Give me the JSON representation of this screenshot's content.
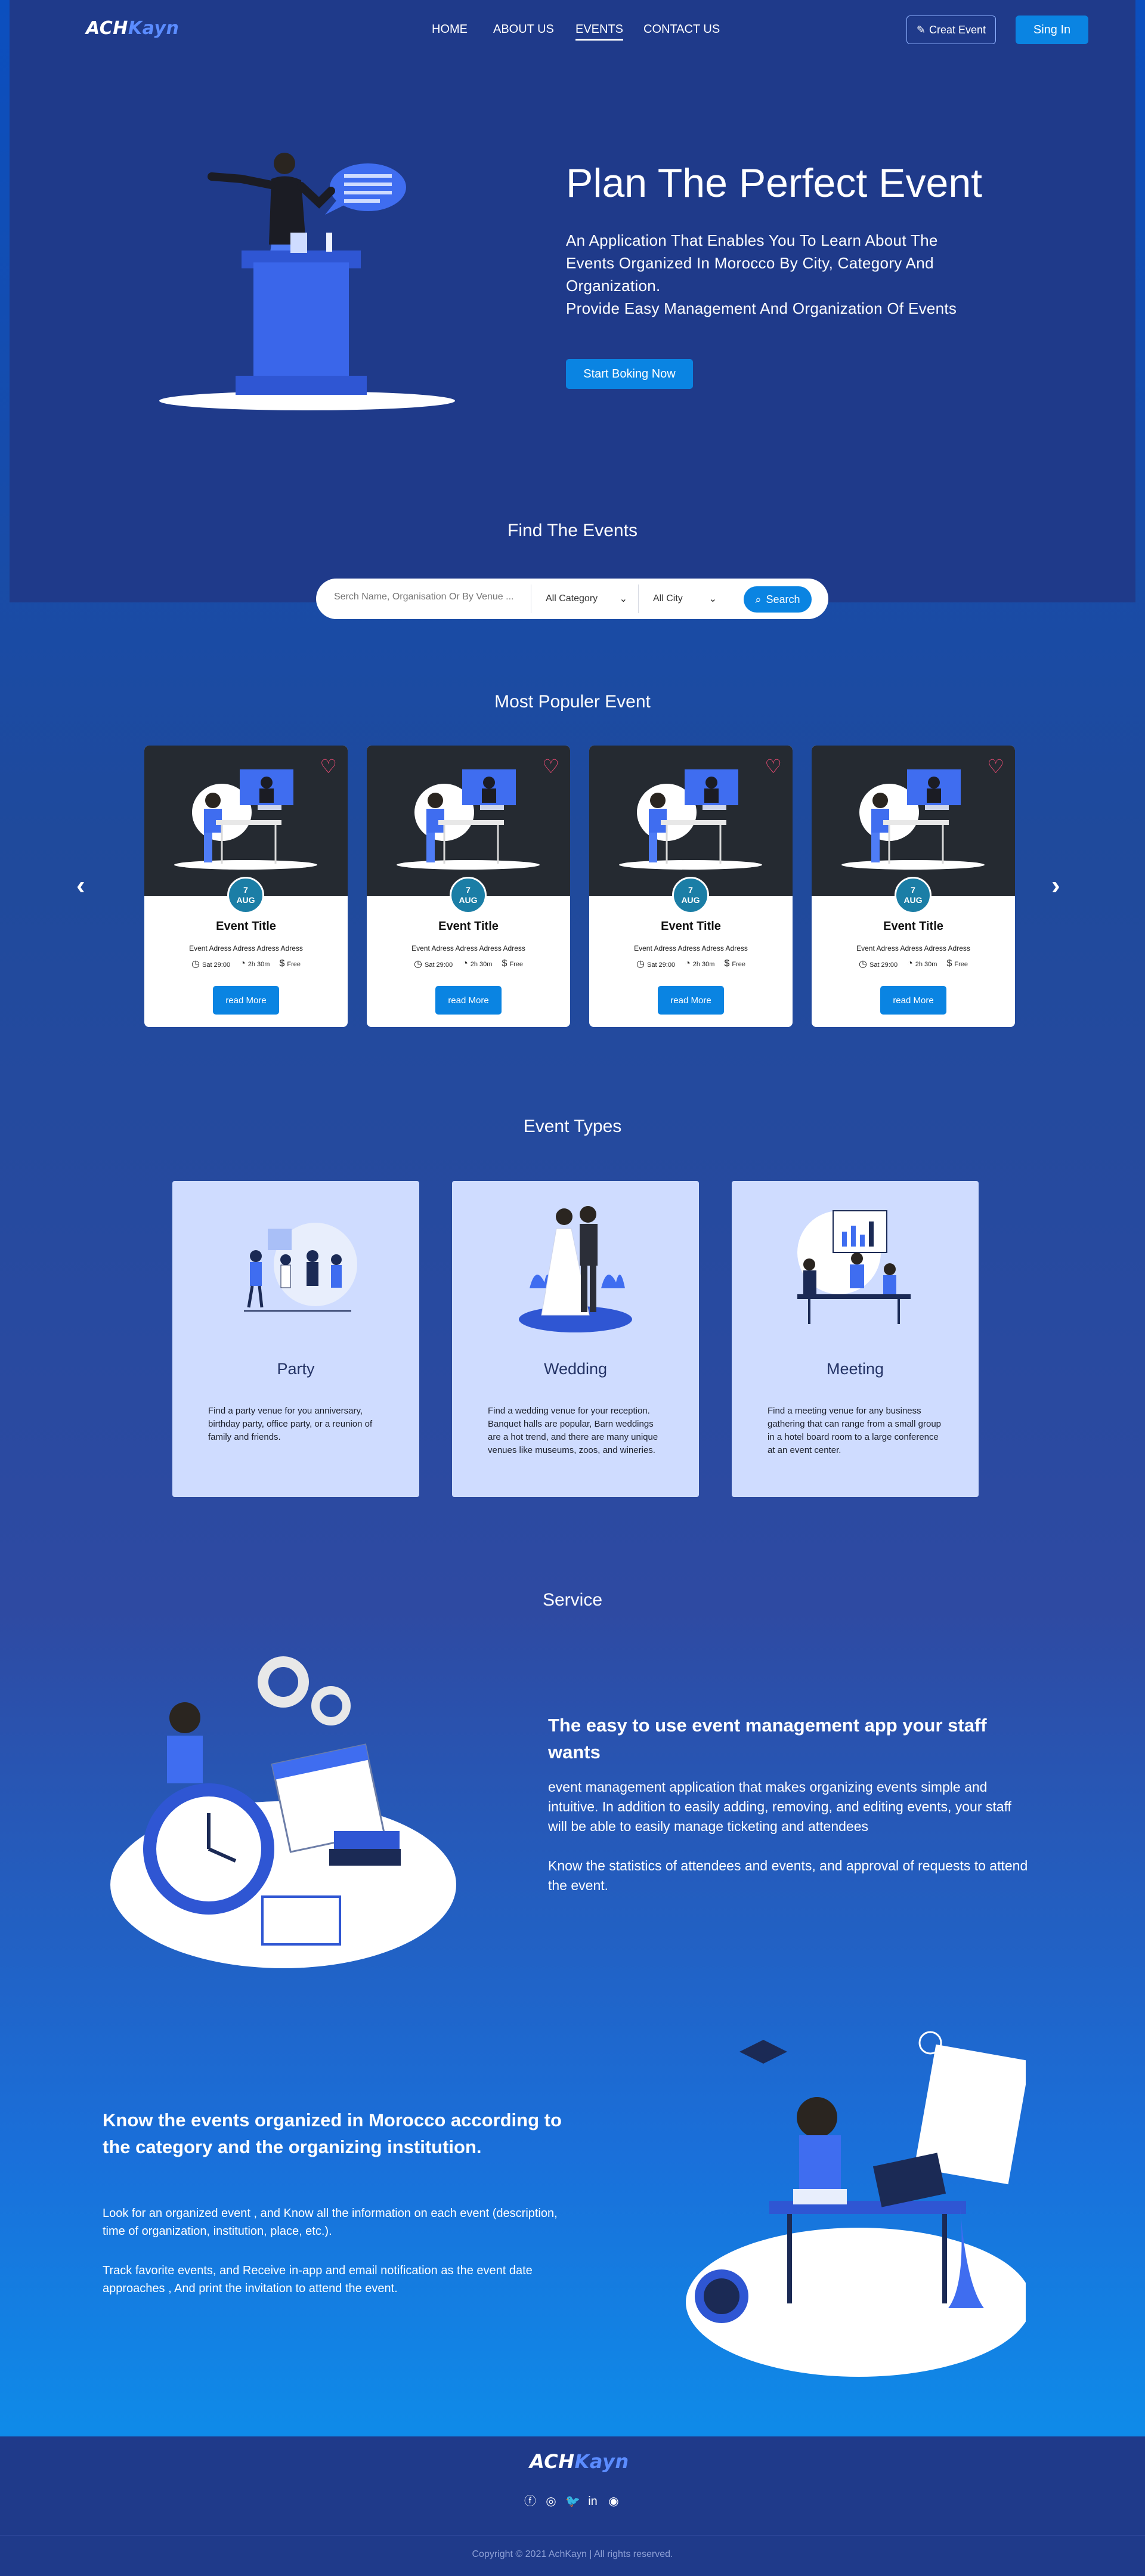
{
  "nav": {
    "logo_a": "ACH",
    "logo_b": "Kayn",
    "links": [
      "HOME",
      "ABOUT US",
      "EVENTS",
      "CONTACT US"
    ],
    "active": "EVENTS",
    "create_label": "Creat Event",
    "signin_label": "Sing In"
  },
  "hero": {
    "title": "Plan The Perfect Event",
    "description": "An Application That Enables You To Learn About The Events Organized In Morocco By City, Category And Organization.\nProvide Easy Management And Organization Of Events",
    "cta": "Start Boking Now"
  },
  "find": {
    "title": "Find The Events",
    "placeholder": "Serch Name, Organisation Or By Venue ...",
    "category": "All Category",
    "city": "All City",
    "search_label": "Search"
  },
  "popular": {
    "title": "Most Populer Event",
    "cards": [
      {
        "day": "7",
        "month": "AUG",
        "title": "Event Title",
        "address": "Event Adress Adress Adress Adress",
        "date": "Sat 29:00",
        "duration": "2h 30m",
        "price": "Free",
        "button": "read More"
      },
      {
        "day": "7",
        "month": "AUG",
        "title": "Event Title",
        "address": "Event Adress Adress Adress Adress",
        "date": "Sat 29:00",
        "duration": "2h 30m",
        "price": "Free",
        "button": "read More"
      },
      {
        "day": "7",
        "month": "AUG",
        "title": "Event Title",
        "address": "Event Adress Adress Adress Adress",
        "date": "Sat 29:00",
        "duration": "2h 30m",
        "price": "Free",
        "button": "read More"
      },
      {
        "day": "7",
        "month": "AUG",
        "title": "Event Title",
        "address": "Event Adress Adress Adress Adress",
        "date": "Sat 29:00",
        "duration": "2h 30m",
        "price": "Free",
        "button": "read More"
      }
    ]
  },
  "types": {
    "title": "Event Types",
    "cards": [
      {
        "name": "Party",
        "description": "Find a party venue for you anniversary, birthday party, office party, or a reunion of family and friends."
      },
      {
        "name": "Wedding",
        "description": "Find a wedding venue for your reception. Banquet halls are popular, Barn weddings are a hot trend, and there are many unique venues like museums, zoos, and wineries."
      },
      {
        "name": "Meeting",
        "description": "Find a meeting venue for any business gathering that can range from a small group in a hotel board room to a large conference at an event center."
      }
    ]
  },
  "service": {
    "title": "Service",
    "heading": "The easy to use event management app your staff wants",
    "p1": "event management application that makes organizing events simple and intuitive. In addition to easily adding, removing, and editing events, your staff will be able to easily manage ticketing and attendees",
    "p2": "Know the statistics of attendees and events, and approval of requests to attend the event."
  },
  "know": {
    "heading": "Know the events organized in Morocco according to the category and the organizing institution.",
    "p1": "Look for an organized event , and Know all the information on each event (description, time of organization, institution, place, etc.).",
    "p2": "Track favorite events, and Receive in-app and email notification as the event date approaches , And print the invitation to attend the event."
  },
  "footer": {
    "logo_a": "ACH",
    "logo_b": "Kayn",
    "social": [
      "facebook-icon",
      "instagram-icon",
      "twitter-icon",
      "linkedin-icon",
      "github-icon"
    ],
    "copyright": "Copyright © 2021 AchKayn | All rights reserved."
  }
}
